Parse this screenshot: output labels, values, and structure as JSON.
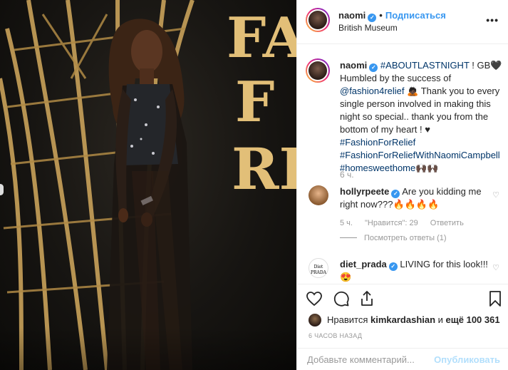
{
  "photo": {
    "backdrop_text": [
      "FAS",
      "F",
      "RE"
    ]
  },
  "header": {
    "username": "naomi",
    "verified_mark": "✓",
    "separator": "•",
    "follow_label": "Подписаться",
    "location": "British Museum",
    "more_icon": "•••"
  },
  "caption": {
    "username": "naomi",
    "hashtag1": "#ABOUTLASTNIGHT",
    "after_hashtag1": " ! GB🖤",
    "line2": "Humbled by the success of",
    "mention": "@fashion4relief",
    "after_mention": " 🙇🏿 Thank you to every single person involved in making this night so special.. thank you from the bottom of my heart ! ♥",
    "hashtag2": "#FashionForRelief",
    "hashtag3": "#FashionForReliefWithNaomiCampbell",
    "hashtag4": "#homesweethome",
    "hashtag4_emoji": "🙌🏿🙌🏿",
    "time": "6 ч."
  },
  "comments": [
    {
      "username": "hollyrpeete",
      "text": "Are you kidding me right now???🔥🔥🔥🔥",
      "time": "5 ч.",
      "likes": "\"Нравится\": 29",
      "reply": "Ответить",
      "replies": "Посмотреть ответы (1)"
    },
    {
      "username": "diet_prada",
      "avatar_text": "Diet PRADA",
      "text": "LIVING for this look!!! 😍"
    }
  ],
  "likes": {
    "prefix": "Нравится",
    "user": "kimkardashian",
    "middle": " и ",
    "count": "ещё 100 361"
  },
  "posted_ago": "6 ЧАСОВ НАЗАД",
  "comment_box": {
    "placeholder": "Добавьте комментарий...",
    "publish_label": "Опубликовать"
  },
  "colors": {
    "link": "#003569",
    "accent": "#3897f0",
    "gold": "#c9a25a"
  },
  "icons": [
    "heart-icon",
    "comment-icon",
    "share-icon",
    "bookmark-icon",
    "more-icon",
    "verified-icon"
  ]
}
